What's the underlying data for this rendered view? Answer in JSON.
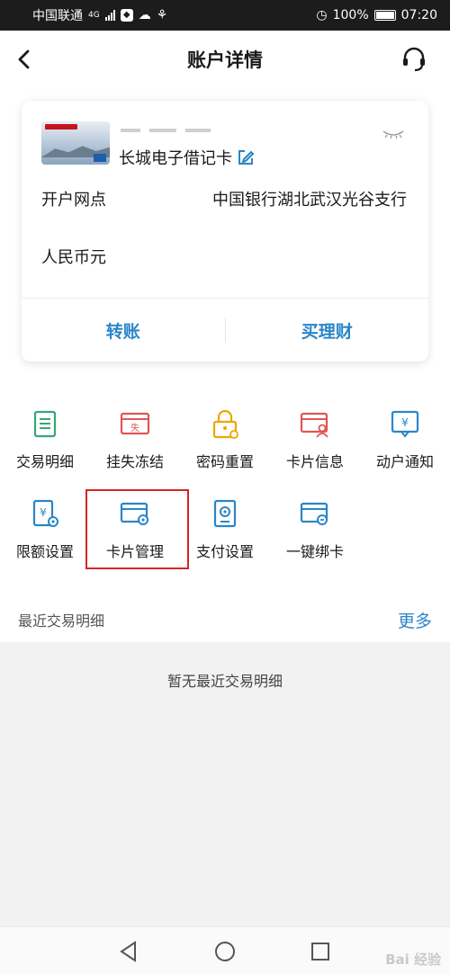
{
  "status_bar": {
    "carrier": "中国联通",
    "network": "4G",
    "battery": "100%",
    "time": "07:20"
  },
  "header": {
    "title": "账户详情"
  },
  "account_card": {
    "card_name": "长城电子借记卡",
    "branch_label": "开户网点",
    "branch_value": "中国银行湖北武汉光谷支行",
    "currency_label": "人民币元",
    "actions": {
      "transfer": "转账",
      "wealth": "买理财"
    }
  },
  "functions": [
    {
      "label": "交易明细",
      "icon": "transaction-list-icon",
      "color": "#3aa676"
    },
    {
      "label": "挂失冻结",
      "icon": "report-loss-icon",
      "color": "#e05555"
    },
    {
      "label": "密码重置",
      "icon": "password-lock-icon",
      "color": "#f0a500"
    },
    {
      "label": "卡片信息",
      "icon": "card-info-icon",
      "color": "#e05555"
    },
    {
      "label": "动户通知",
      "icon": "account-notify-icon",
      "color": "#2a86c8"
    },
    {
      "label": "限额设置",
      "icon": "limit-settings-icon",
      "color": "#2a86c8"
    },
    {
      "label": "卡片管理",
      "icon": "card-manage-icon",
      "color": "#2a86c8"
    },
    {
      "label": "支付设置",
      "icon": "payment-settings-icon",
      "color": "#2a86c8"
    },
    {
      "label": "一键绑卡",
      "icon": "bind-card-icon",
      "color": "#2a86c8"
    }
  ],
  "recent": {
    "title": "最近交易明细",
    "more": "更多",
    "empty_message": "暂无最近交易明细"
  },
  "watermark": "Bai 经验"
}
